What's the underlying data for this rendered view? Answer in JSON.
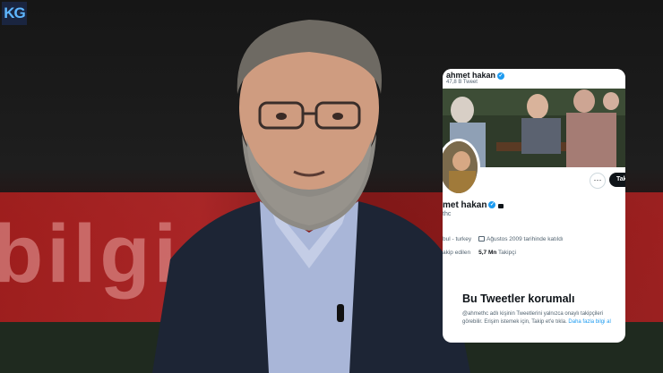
{
  "logo": {
    "text": "KG"
  },
  "background": {
    "studio_text": "bilgi"
  },
  "profile": {
    "header_name": "ahmet hakan",
    "tweet_count": "47,8 B Tweet",
    "name": "met hakan",
    "handle": "thc",
    "location": "bul - turkey",
    "joined": "Ağustos 2009 tarihinde katıldı",
    "following_label": "akip edilen",
    "followers_count": "5,7 Mn",
    "followers_label": "Takipçi",
    "follow_button": "Tak",
    "more_button": "···",
    "protected_title": "Bu Tweetler korumalı",
    "protected_text": "@ahmethc adlı kişinin Tweetlerini yalnızca onaylı takipçileri görebilir. Erişim istemek için, Takip et'e tıkla.",
    "learn_more": "Daha fazla bilgi al"
  },
  "colors": {
    "accent": "#1d9bf0",
    "studio_red": "#c0292a"
  }
}
